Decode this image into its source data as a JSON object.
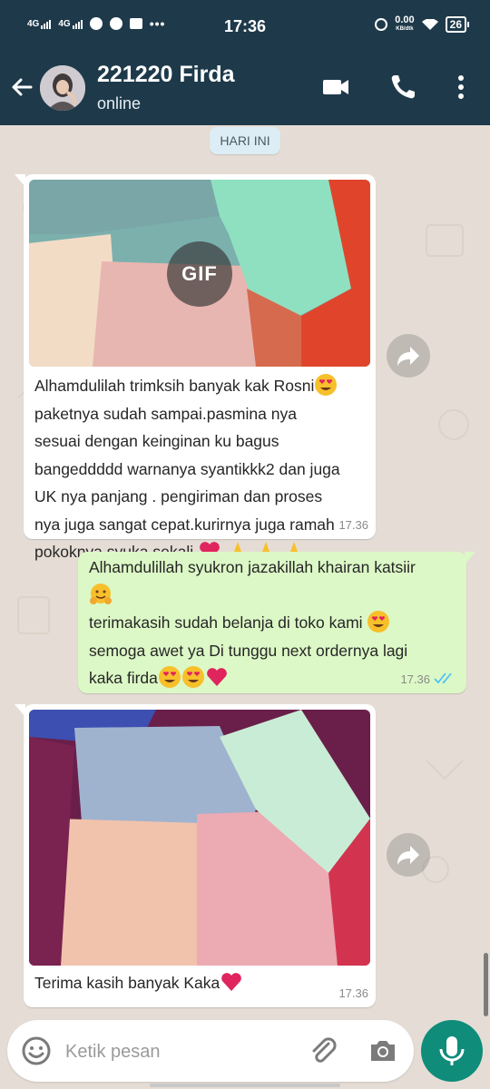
{
  "status_bar": {
    "net1": "4G",
    "net2": "4G",
    "time": "17:36",
    "speed_value": "0.00",
    "speed_unit": "KB/dtk",
    "battery": "26"
  },
  "header": {
    "contact_name": "221220 Firda",
    "status": "online"
  },
  "chat": {
    "date_chip": "HARI INI",
    "messages": [
      {
        "direction": "in",
        "media": "gif",
        "media_badge": "GIF",
        "lines": [
          "Alhamdulilah trimksih banyak kak Rosni",
          "paketnya sudah sampai.pasmina nya",
          "sesuai dengan keinginan ku bagus",
          "bangeddddd warnanya syantikkk2 dan juga",
          "UK nya panjang . pengiriman dan proses",
          "nya juga sangat cepat.kurirnya juga ramah",
          "pokoknya syuka sekali"
        ],
        "time": "17.36"
      },
      {
        "direction": "out",
        "lines": [
          "Alhamdulillah syukron jazakillah khairan katsiir",
          "",
          "terimakasih sudah belanja di toko kami",
          "semoga awet ya Di tunggu next ordernya lagi",
          "kaka firda"
        ],
        "time": "17.36",
        "status": "read"
      },
      {
        "direction": "in",
        "media": "image",
        "lines": [
          "Terima kasih banyak Kaka"
        ],
        "time": "17.36"
      }
    ]
  },
  "composer": {
    "placeholder": "Ketik pesan"
  },
  "colors": {
    "header_bg": "#1e3a4a",
    "chat_bg": "#e5ddd5",
    "incoming_bubble": "#ffffff",
    "outgoing_bubble": "#dcf8c6",
    "accent": "#0f8c7a",
    "read_ticks": "#4fc3f7"
  },
  "icons": {
    "back": "arrow-left-icon",
    "video_call": "video-camera-icon",
    "voice_call": "phone-icon",
    "menu": "more-vertical-icon",
    "forward": "share-arrow-icon",
    "emoji": "smiley-icon",
    "attach": "paperclip-icon",
    "camera": "camera-icon",
    "mic": "microphone-icon"
  }
}
